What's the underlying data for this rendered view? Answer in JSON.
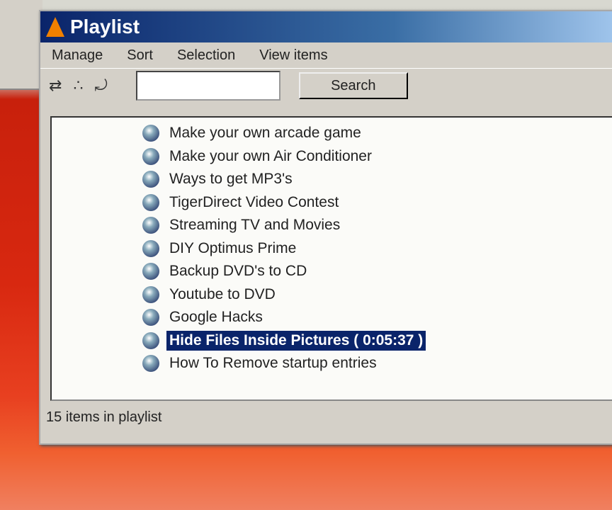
{
  "window": {
    "title": "Playlist"
  },
  "menu": [
    "Manage",
    "Sort",
    "Selection",
    "View items"
  ],
  "toolbar": {
    "search_value": "",
    "search_label": "Search"
  },
  "playlist": [
    {
      "title": "Make your own arcade game",
      "selected": false
    },
    {
      "title": "Make your own Air Conditioner",
      "selected": false
    },
    {
      "title": "Ways to get MP3's",
      "selected": false
    },
    {
      "title": "TigerDirect Video Contest",
      "selected": false
    },
    {
      "title": "Streaming TV and Movies",
      "selected": false
    },
    {
      "title": "DIY Optimus Prime",
      "selected": false
    },
    {
      "title": "Backup DVD's to CD",
      "selected": false
    },
    {
      "title": "Youtube to DVD",
      "selected": false
    },
    {
      "title": "Google Hacks",
      "selected": false
    },
    {
      "title": "Hide Files Inside Pictures ( 0:05:37 )",
      "selected": true
    },
    {
      "title": "How To Remove startup entries",
      "selected": false
    }
  ],
  "status": "15 items in playlist"
}
